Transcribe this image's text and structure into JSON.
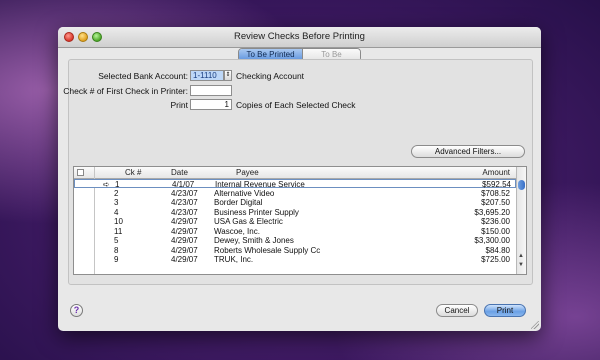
{
  "window": {
    "title": "Review Checks Before Printing"
  },
  "tabs": [
    {
      "label": "To Be Printed",
      "active": true
    },
    {
      "label": "To Be Emailed",
      "active": false
    }
  ],
  "form": {
    "bank_account_label": "Selected Bank Account:",
    "bank_account_value": "1-1110",
    "bank_account_name": "Checking Account",
    "first_check_label": "Check # of First Check in Printer:",
    "first_check_value": "",
    "print_label": "Print",
    "copies_value": "1",
    "copies_suffix": "Copies of Each Selected Check"
  },
  "buttons": {
    "advanced_filters": "Advanced Filters...",
    "cancel": "Cancel",
    "print": "Print",
    "help": "?"
  },
  "table": {
    "columns": {
      "check_num": "Ck #",
      "date": "Date",
      "payee": "Payee",
      "amount": "Amount"
    },
    "rows": [
      {
        "marker": "➪",
        "num": "1",
        "date": "4/1/07",
        "payee": "Internal Revenue Service",
        "amount": "$592.54",
        "selected": true
      },
      {
        "marker": "",
        "num": "2",
        "date": "4/23/07",
        "payee": "Alternative Video",
        "amount": "$708.52"
      },
      {
        "marker": "",
        "num": "3",
        "date": "4/23/07",
        "payee": "Border Digital",
        "amount": "$207.50"
      },
      {
        "marker": "",
        "num": "4",
        "date": "4/23/07",
        "payee": "Business Printer Supply",
        "amount": "$3,695.20"
      },
      {
        "marker": "",
        "num": "10",
        "date": "4/29/07",
        "payee": "USA Gas & Electric",
        "amount": "$236.00"
      },
      {
        "marker": "",
        "num": "11",
        "date": "4/29/07",
        "payee": "Wascoe, Inc.",
        "amount": "$150.00"
      },
      {
        "marker": "",
        "num": "5",
        "date": "4/29/07",
        "payee": "Dewey, Smith & Jones",
        "amount": "$3,300.00"
      },
      {
        "marker": "",
        "num": "8",
        "date": "4/29/07",
        "payee": "Roberts Wholesale Supply Cc",
        "amount": "$84.80"
      },
      {
        "marker": "",
        "num": "9",
        "date": "4/29/07",
        "payee": "TRUK, Inc.",
        "amount": "$725.00"
      }
    ]
  },
  "scrollbar": {
    "up_arrow": "▲",
    "down_arrow": "▼"
  },
  "colors": {
    "accent": "#5d93dd",
    "selection": "#bdd7f7",
    "wallpaper": "#3e1a62"
  }
}
